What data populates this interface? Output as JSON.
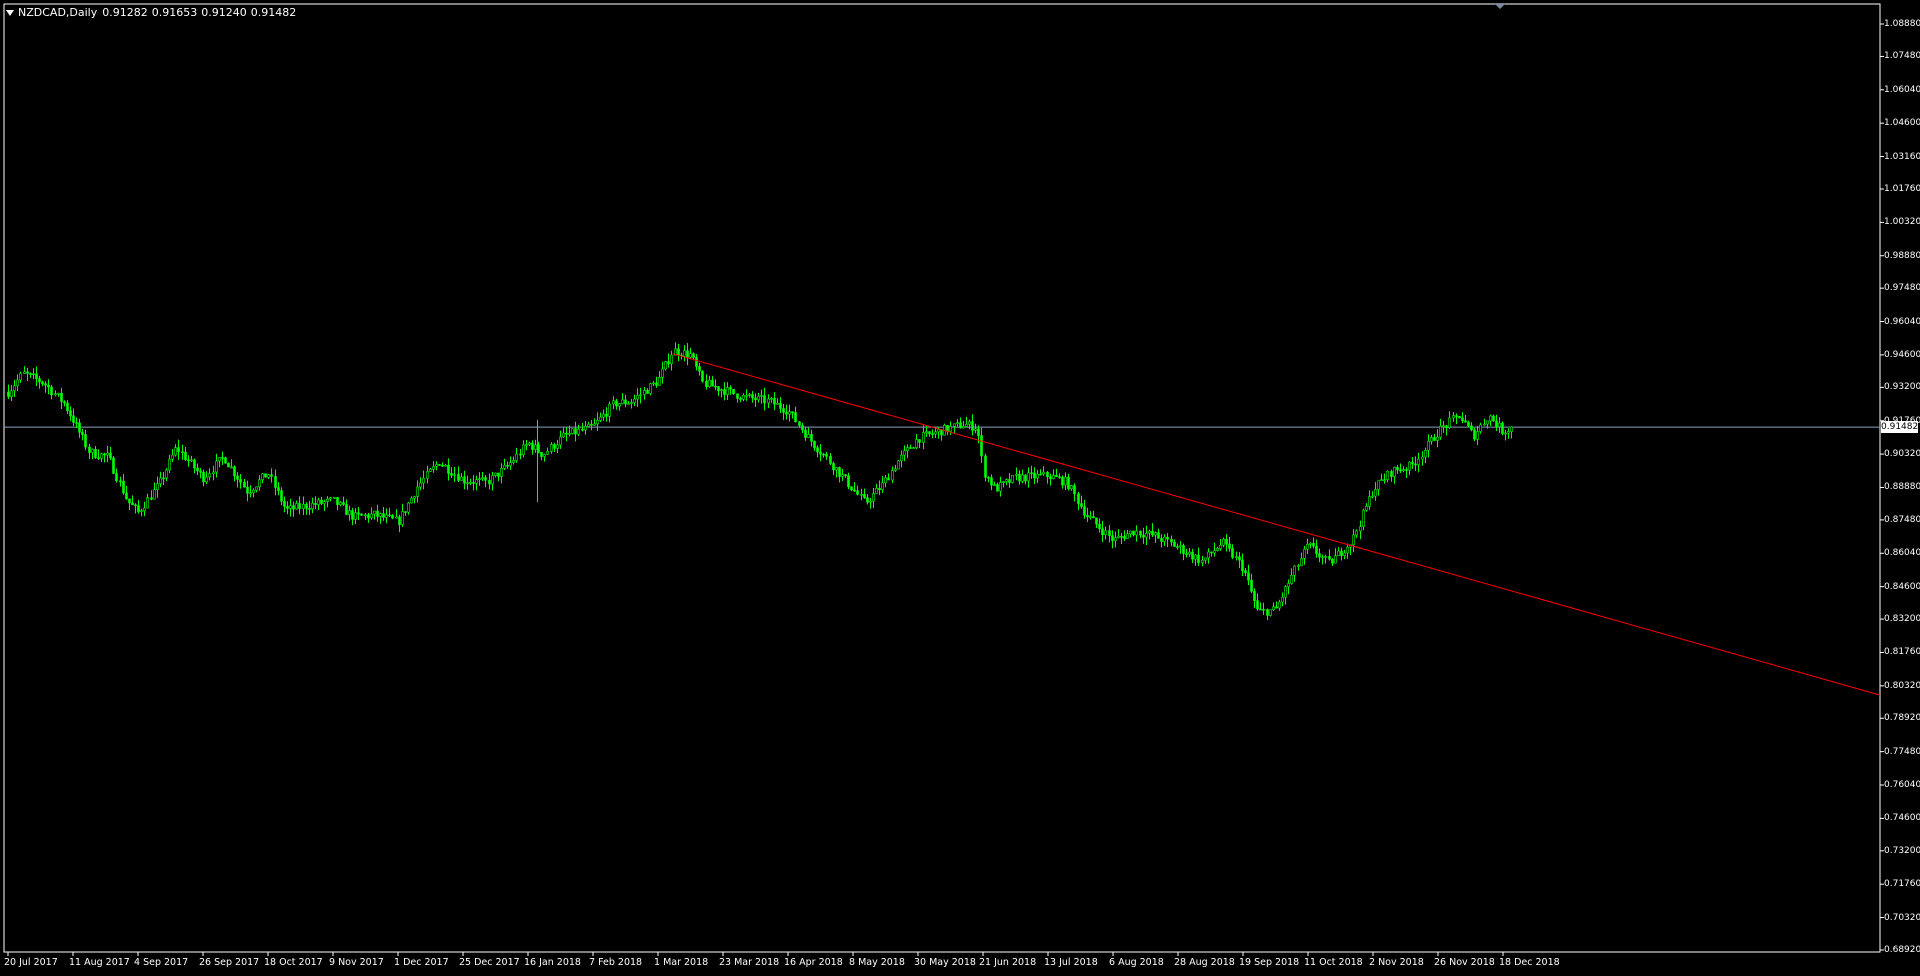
{
  "header": {
    "symbol": "NZDCAD,Daily",
    "open": "0.91282",
    "high": "0.91653",
    "low": "0.91240",
    "close": "0.91482"
  },
  "colors": {
    "background": "#000000",
    "axis": "#ffffff",
    "candle": "#00ff00",
    "trendline": "#ff0000",
    "price_line": "#8aa0b8"
  },
  "chart_data": {
    "type": "candlestick",
    "title": "",
    "xlabel": "",
    "ylabel": "",
    "ylim": [
      0.6892,
      1.0888
    ],
    "grid": false,
    "yticks": [
      "1.08880",
      "1.07480",
      "1.06040",
      "1.04600",
      "1.03160",
      "1.01760",
      "1.00320",
      "0.98880",
      "0.97480",
      "0.96040",
      "0.94600",
      "0.93200",
      "0.91760",
      "0.90320",
      "0.88880",
      "0.87480",
      "0.86040",
      "0.84600",
      "0.83200",
      "0.81760",
      "0.80320",
      "0.78920",
      "0.77480",
      "0.76040",
      "0.74600",
      "0.73200",
      "0.71760",
      "0.70320",
      "0.68920"
    ],
    "xticks": [
      "20 Jul 2017",
      "11 Aug 2017",
      "4 Sep 2017",
      "26 Sep 2017",
      "18 Oct 2017",
      "9 Nov 2017",
      "1 Dec 2017",
      "25 Dec 2017",
      "16 Jan 2018",
      "7 Feb 2018",
      "1 Mar 2018",
      "23 Mar 2018",
      "16 Apr 2018",
      "8 May 2018",
      "30 May 2018",
      "21 Jun 2018",
      "13 Jul 2018",
      "6 Aug 2018",
      "28 Aug 2018",
      "19 Sep 2018",
      "11 Oct 2018",
      "2 Nov 2018",
      "26 Nov 2018",
      "18 Dec 2018"
    ],
    "current_price": "0.91482",
    "path": [
      [
        "20 Jul 2017",
        0.93
      ],
      [
        "25 Jul 2017",
        0.938
      ],
      [
        "1 Aug 2017",
        0.934
      ],
      [
        "8 Aug 2017",
        0.925
      ],
      [
        "11 Aug 2017",
        0.918
      ],
      [
        "17 Aug 2017",
        0.904
      ],
      [
        "24 Aug 2017",
        0.902
      ],
      [
        "31 Aug 2017",
        0.883
      ],
      [
        "4 Sep 2017",
        0.878
      ],
      [
        "11 Sep 2017",
        0.89
      ],
      [
        "17 Sep 2017",
        0.906
      ],
      [
        "26 Sep 2017",
        0.893
      ],
      [
        "3 Oct 2017",
        0.902
      ],
      [
        "11 Oct 2017",
        0.887
      ],
      [
        "18 Oct 2017",
        0.895
      ],
      [
        "24 Oct 2017",
        0.879
      ],
      [
        "31 Oct 2017",
        0.881
      ],
      [
        "9 Nov 2017",
        0.883
      ],
      [
        "16 Nov 2017",
        0.876
      ],
      [
        "23 Nov 2017",
        0.877
      ],
      [
        "1 Dec 2017",
        0.874
      ],
      [
        "8 Dec 2017",
        0.889
      ],
      [
        "16 Dec 2017",
        0.9
      ],
      [
        "25 Dec 2017",
        0.892
      ],
      [
        "2 Jan 2018",
        0.891
      ],
      [
        "9 Jan 2018",
        0.898
      ],
      [
        "16 Jan 2018",
        0.908
      ],
      [
        "21 Jan 2018",
        0.903
      ],
      [
        "28 Jan 2018",
        0.911
      ],
      [
        "7 Feb 2018",
        0.915
      ],
      [
        "14 Feb 2018",
        0.925
      ],
      [
        "20 Feb 2018",
        0.926
      ],
      [
        "1 Mar 2018",
        0.935
      ],
      [
        "6 Mar 2018",
        0.948
      ],
      [
        "12 Mar 2018",
        0.946
      ],
      [
        "16 Mar 2018",
        0.934
      ],
      [
        "23 Mar 2018",
        0.931
      ],
      [
        "30 Mar 2018",
        0.928
      ],
      [
        "9 Apr 2018",
        0.926
      ],
      [
        "16 Apr 2018",
        0.922
      ],
      [
        "23 Apr 2018",
        0.91
      ],
      [
        "30 Apr 2018",
        0.9
      ],
      [
        "8 May 2018",
        0.888
      ],
      [
        "12 May 2018",
        0.882
      ],
      [
        "18 May 2018",
        0.89
      ],
      [
        "23 May 2018",
        0.9
      ],
      [
        "30 May 2018",
        0.91
      ],
      [
        "6 Jun 2018",
        0.913
      ],
      [
        "14 Jun 2018",
        0.916
      ],
      [
        "19 Jun 2018",
        0.915
      ],
      [
        "21 Jun 2018",
        0.896
      ],
      [
        "25 Jun 2018",
        0.888
      ],
      [
        "2 Jul 2018",
        0.893
      ],
      [
        "13 Jul 2018",
        0.894
      ],
      [
        "20 Jul 2018",
        0.891
      ],
      [
        "27 Jul 2018",
        0.877
      ],
      [
        "6 Aug 2018",
        0.866
      ],
      [
        "13 Aug 2018",
        0.87
      ],
      [
        "20 Aug 2018",
        0.868
      ],
      [
        "28 Aug 2018",
        0.863
      ],
      [
        "5 Sep 2018",
        0.857
      ],
      [
        "12 Sep 2018",
        0.865
      ],
      [
        "19 Sep 2018",
        0.854
      ],
      [
        "24 Sep 2018",
        0.835
      ],
      [
        "30 Sep 2018",
        0.836
      ],
      [
        "6 Oct 2018",
        0.852
      ],
      [
        "11 Oct 2018",
        0.864
      ],
      [
        "18 Oct 2018",
        0.856
      ],
      [
        "26 Oct 2018",
        0.866
      ],
      [
        "2 Nov 2018",
        0.888
      ],
      [
        "9 Nov 2018",
        0.896
      ],
      [
        "16 Nov 2018",
        0.898
      ],
      [
        "21 Nov 2018",
        0.905
      ],
      [
        "26 Nov 2018",
        0.913
      ],
      [
        "3 Dec 2018",
        0.92
      ],
      [
        "8 Dec 2018",
        0.911
      ],
      [
        "13 Dec 2018",
        0.92
      ],
      [
        "18 Dec 2018",
        0.913
      ],
      [
        "21 Dec 2018",
        0.9148
      ]
    ],
    "annotations": {
      "trendline": {
        "from": {
          "date": "6 Mar 2018",
          "price": 0.9465
        },
        "to_price_at_right_edge": 0.7992,
        "color": "#ff0000"
      },
      "horizontal_line": {
        "price": 0.91482,
        "color": "#8aa0b8"
      }
    }
  }
}
